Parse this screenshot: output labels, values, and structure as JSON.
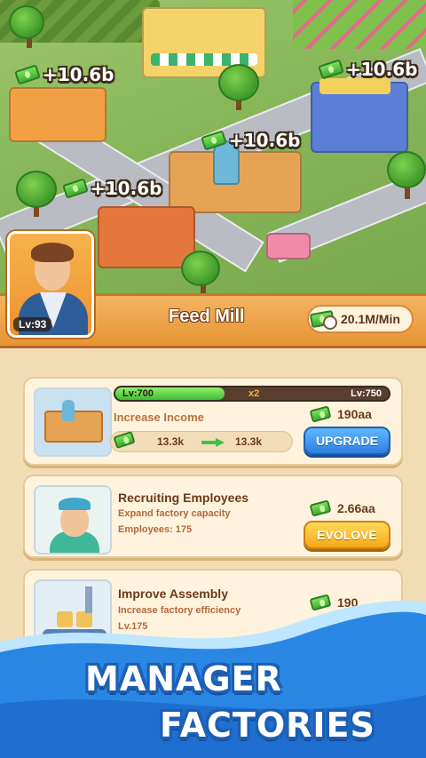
{
  "scene": {
    "income_tags": [
      "+10.6b",
      "+10.6b",
      "+10.6b",
      "+10.6b"
    ]
  },
  "manager": {
    "level": "Lv:93"
  },
  "header": {
    "title": "Feed Mill",
    "rate": "20.1M/Min"
  },
  "cards": {
    "income": {
      "level_current": "Lv:700",
      "multiplier": "x2",
      "level_next": "Lv:750",
      "progress": 0.4,
      "title": "Increase Income",
      "from": "13.3k",
      "to": "13.3k",
      "cost": "190aa",
      "button": "UPGRADE"
    },
    "employees": {
      "title": "Recruiting Employees",
      "line1": "Expand factory capacity",
      "line2": "Employees: 175",
      "cost": "2.66aa",
      "button": "EVOLOVE"
    },
    "assembly": {
      "title": "Improve Assembly",
      "line1": "Increase factory efficiency",
      "line2": "Lv.175",
      "cost": "190"
    }
  },
  "promo": {
    "line1": "MANAGER",
    "line2": "FACTORIES"
  },
  "colors": {
    "header_orange": "#e89435",
    "button_blue": "#2e7fe0",
    "button_gold": "#f5a818",
    "wave_blue": "#2a86e3"
  }
}
